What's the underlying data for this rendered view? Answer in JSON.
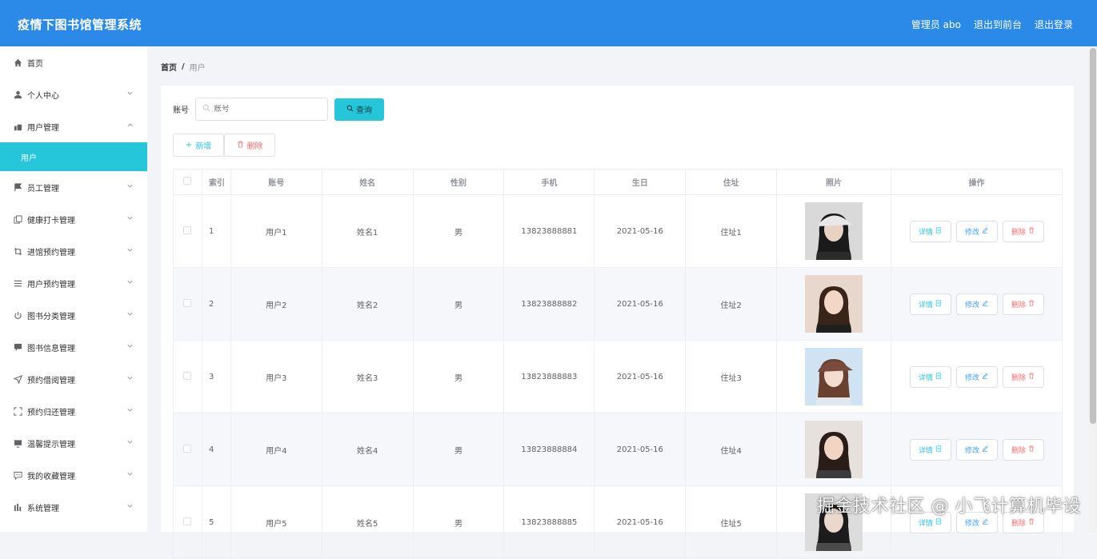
{
  "header": {
    "title": "疫情下图书馆管理系统",
    "admin_label": "管理员 abo",
    "front_label": "退出到前台",
    "logout_label": "退出登录",
    "color": "#2b89e8"
  },
  "sidebar": {
    "items": [
      {
        "label": "首页",
        "icon": "home-icon",
        "has_chevron": false
      },
      {
        "label": "个人中心",
        "icon": "user-icon",
        "has_chevron": true
      },
      {
        "label": "用户管理",
        "icon": "users-icon",
        "has_chevron": true,
        "expanded": true
      },
      {
        "label": "员工管理",
        "icon": "flag-icon",
        "has_chevron": true
      },
      {
        "label": "健康打卡管理",
        "icon": "copy-icon",
        "has_chevron": true
      },
      {
        "label": "进馆预约管理",
        "icon": "crop-icon",
        "has_chevron": true
      },
      {
        "label": "用户预约管理",
        "icon": "list-icon",
        "has_chevron": true
      },
      {
        "label": "图书分类管理",
        "icon": "power-icon",
        "has_chevron": true
      },
      {
        "label": "图书信息管理",
        "icon": "comment-icon",
        "has_chevron": true
      },
      {
        "label": "预约借阅管理",
        "icon": "send-icon",
        "has_chevron": true
      },
      {
        "label": "预约归还管理",
        "icon": "fullscreen-icon",
        "has_chevron": true
      },
      {
        "label": "温馨提示管理",
        "icon": "monitor-icon",
        "has_chevron": true
      },
      {
        "label": "我的收藏管理",
        "icon": "chat-icon",
        "has_chevron": true
      },
      {
        "label": "系统管理",
        "icon": "chart-icon",
        "has_chevron": true
      }
    ],
    "active_sub": "用户",
    "accent": "#26c6da"
  },
  "breadcrumb": {
    "home": "首页",
    "sep": "/",
    "current": "用户"
  },
  "search": {
    "label": "账号",
    "placeholder": "账号",
    "button": "查询"
  },
  "actions": {
    "add": "新增",
    "delete": "删除"
  },
  "table": {
    "headers": [
      "索引",
      "账号",
      "姓名",
      "性别",
      "手机",
      "生日",
      "住址",
      "照片",
      "操作"
    ],
    "rows": [
      {
        "index": "1",
        "account": "用户1",
        "name": "姓名1",
        "gender": "男",
        "phone": "13823888881",
        "birthday": "2021-05-16",
        "address": "住址1"
      },
      {
        "index": "2",
        "account": "用户2",
        "name": "姓名2",
        "gender": "男",
        "phone": "13823888882",
        "birthday": "2021-05-16",
        "address": "住址2"
      },
      {
        "index": "3",
        "account": "用户3",
        "name": "姓名3",
        "gender": "男",
        "phone": "13823888883",
        "birthday": "2021-05-16",
        "address": "住址3"
      },
      {
        "index": "4",
        "account": "用户4",
        "name": "姓名4",
        "gender": "男",
        "phone": "13823888884",
        "birthday": "2021-05-16",
        "address": "住址4"
      },
      {
        "index": "5",
        "account": "用户5",
        "name": "姓名5",
        "gender": "男",
        "phone": "13823888885",
        "birthday": "2021-05-16",
        "address": "住址5"
      }
    ],
    "row_ops": {
      "detail": "详情",
      "edit": "修改",
      "delete": "删除"
    }
  },
  "watermark": "掘金技术社区 @ 小飞计算机毕设"
}
